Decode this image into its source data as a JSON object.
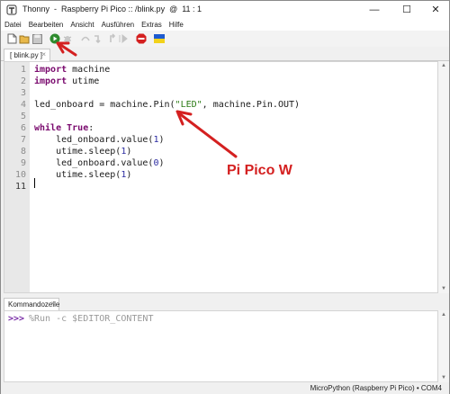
{
  "window": {
    "title": "Thonny  -  Raspberry Pi Pico :: /blink.py  @  11 : 1",
    "minimize_glyph": "—",
    "maximize_glyph": "☐",
    "close_glyph": "✕"
  },
  "menu": {
    "items": [
      "Datei",
      "Bearbeiten",
      "Ansicht",
      "Ausführen",
      "Extras",
      "Hilfe"
    ]
  },
  "toolbar": {
    "icons": [
      "new-file-icon",
      "open-file-icon",
      "save-icon",
      "run-icon",
      "debug-icon",
      "step-over-icon",
      "step-into-icon",
      "step-out-icon",
      "resume-icon",
      "stop-icon",
      "ukraine-flag-icon"
    ],
    "run_color": "#2e8b2e",
    "stop_color": "#d42020"
  },
  "editor": {
    "tab_label": "[ blink.py ]",
    "tab_close": "×",
    "line_numbers": [
      "1",
      "2",
      "3",
      "4",
      "5",
      "6",
      "7",
      "8",
      "9",
      "10",
      "11"
    ],
    "lines": [
      {
        "kw": "import",
        "rest": " machine"
      },
      {
        "kw": "import",
        "rest": " utime"
      },
      {
        "text": ""
      },
      {
        "pre": "led_onboard = machine.Pin(",
        "str": "\"LED\"",
        "post": ", machine.Pin.OUT)"
      },
      {
        "text": ""
      },
      {
        "kw": "while",
        "sp": " ",
        "kw2": "True",
        "rest": ":"
      },
      {
        "pre": "    led_onboard.value(",
        "num": "1",
        "post": ")"
      },
      {
        "pre": "    utime.sleep(",
        "num": "1",
        "post": ")"
      },
      {
        "pre": "    led_onboard.value(",
        "num": "0",
        "post": ")"
      },
      {
        "pre": "    utime.sleep(",
        "num": "1",
        "post": ")"
      },
      {
        "text": ""
      }
    ],
    "current_line": "11"
  },
  "shell": {
    "tab_label": "Kommandozeile",
    "tab_close": "×",
    "prompt": ">>>",
    "command": "%Run -c $EDITOR_CONTENT"
  },
  "status": {
    "text": "MicroPython (Raspberry Pi Pico)  •  COM4"
  },
  "annotation": {
    "label": "Pi Pico W",
    "color": "#d42020"
  }
}
